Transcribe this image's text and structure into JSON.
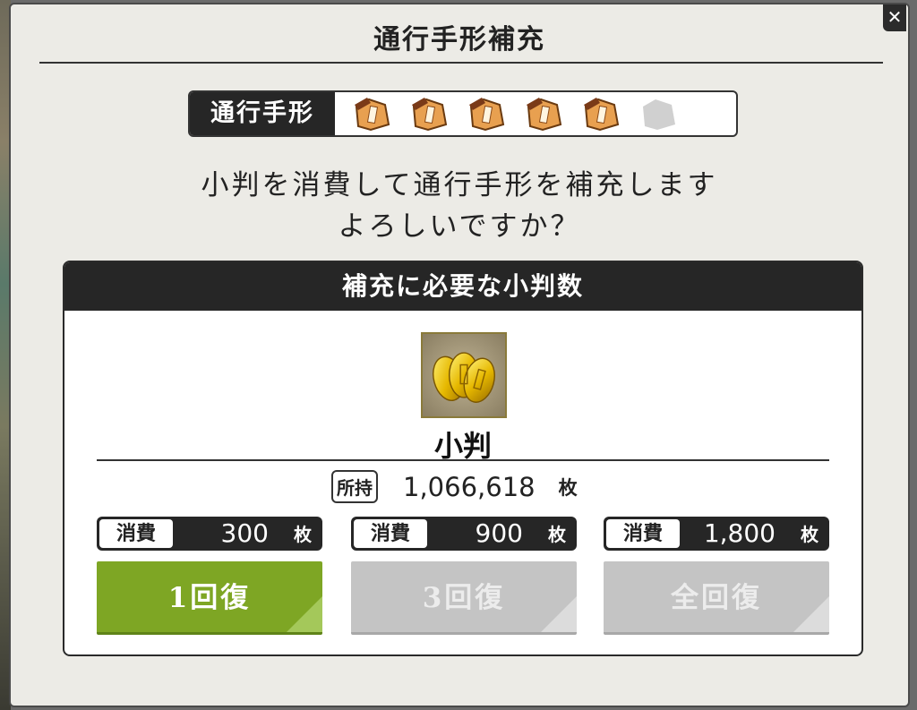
{
  "dialog": {
    "title": "通行手形補充",
    "close_label": "✕"
  },
  "pass": {
    "label": "通行手形",
    "filled": 5,
    "total": 6
  },
  "message": {
    "line1": "小判を消費して通行手形を補充します",
    "line2": "よろしいですか？"
  },
  "panel": {
    "header": "補充に必要な小判数",
    "item_name": "小判",
    "owned_label": "所持",
    "owned_value": "1,066,618",
    "unit": "枚"
  },
  "options": [
    {
      "cost_label": "消費",
      "cost_value": "300",
      "unit": "枚",
      "button_label": "1回復",
      "enabled": true
    },
    {
      "cost_label": "消費",
      "cost_value": "900",
      "unit": "枚",
      "button_label": "3回復",
      "enabled": false
    },
    {
      "cost_label": "消費",
      "cost_value": "1,800",
      "unit": "枚",
      "button_label": "全回復",
      "enabled": false
    }
  ],
  "colors": {
    "accent_green": "#7ea624",
    "disabled_grey": "#c4c4c4",
    "header_dark": "#262626",
    "pass_orange": "#e8a050"
  }
}
